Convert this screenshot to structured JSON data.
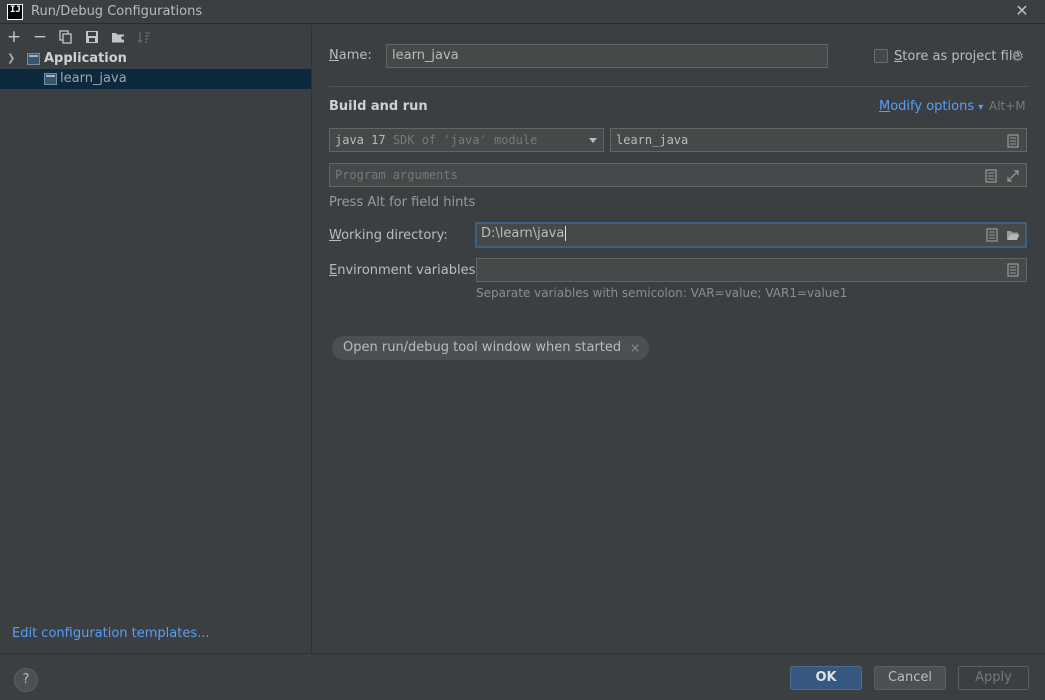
{
  "window": {
    "title": "Run/Debug Configurations",
    "logo_text": "IJ"
  },
  "toolbar": {
    "add": "+",
    "remove": "−"
  },
  "tree": {
    "group_label": "Application",
    "item_label": "learn_java"
  },
  "left_footer": {
    "edit_templates": "Edit configuration templates..."
  },
  "form": {
    "name_label_mnemonic": "N",
    "name_label_rest": "ame:",
    "name_value": "learn_java",
    "store_label_mnemonic": "S",
    "store_label_rest": "tore as project file",
    "section_title": "Build and run",
    "modify_mnemonic": "M",
    "modify_rest": "odify options",
    "modify_shortcut": "Alt+M",
    "jdk_main": "java 17",
    "jdk_detail": "SDK of 'java' module",
    "main_class": "learn_java",
    "program_args_placeholder": "Program arguments",
    "alt_hint": "Press Alt for field hints",
    "workdir_label_mnemonic": "W",
    "workdir_label_rest": "orking directory:",
    "workdir_value": "D:\\learn\\java",
    "env_label_mnemonic": "E",
    "env_label_rest": "nvironment variables:",
    "env_value": "",
    "env_hint": "Separate variables with semicolon: VAR=value; VAR1=value1",
    "chip_label": "Open run/debug tool window when started",
    "chip_close": "×"
  },
  "buttons": {
    "help": "?",
    "ok": "OK",
    "cancel": "Cancel",
    "apply": "Apply"
  },
  "colors": {
    "background": "#3c3f41",
    "link": "#589df6",
    "selection": "#0d293e",
    "ok_button": "#365880"
  }
}
